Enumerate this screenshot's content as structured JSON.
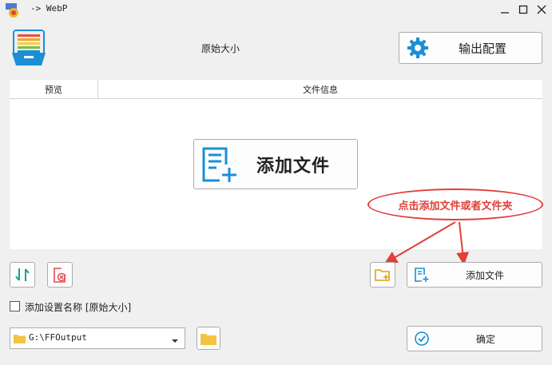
{
  "window": {
    "title": "-> WebP",
    "app_icon": "webp-app-icon",
    "controls": [
      "minimize-icon",
      "maximize-icon",
      "close-icon"
    ]
  },
  "header": {
    "size_label": "原始大小",
    "output_config_label": "输出配置"
  },
  "list": {
    "columns": [
      "预览",
      "文件信息"
    ],
    "add_file_big_label": "添加文件"
  },
  "annotation": {
    "callout_text": "点击添加文件或者文件夹",
    "color": "#e0403a"
  },
  "toolbar": {
    "add_file_label": "添加文件"
  },
  "settings": {
    "add_setting_name_label": "添加设置名称 [原始大小]",
    "checked": false
  },
  "output": {
    "path": "G:\\FFOutput",
    "confirm_label": "确定"
  },
  "colors": {
    "accent_blue": "#1a8fd6",
    "folder_yellow": "#f5c342",
    "delete_red": "#e05050",
    "sort_teal": "#1aa58a"
  }
}
